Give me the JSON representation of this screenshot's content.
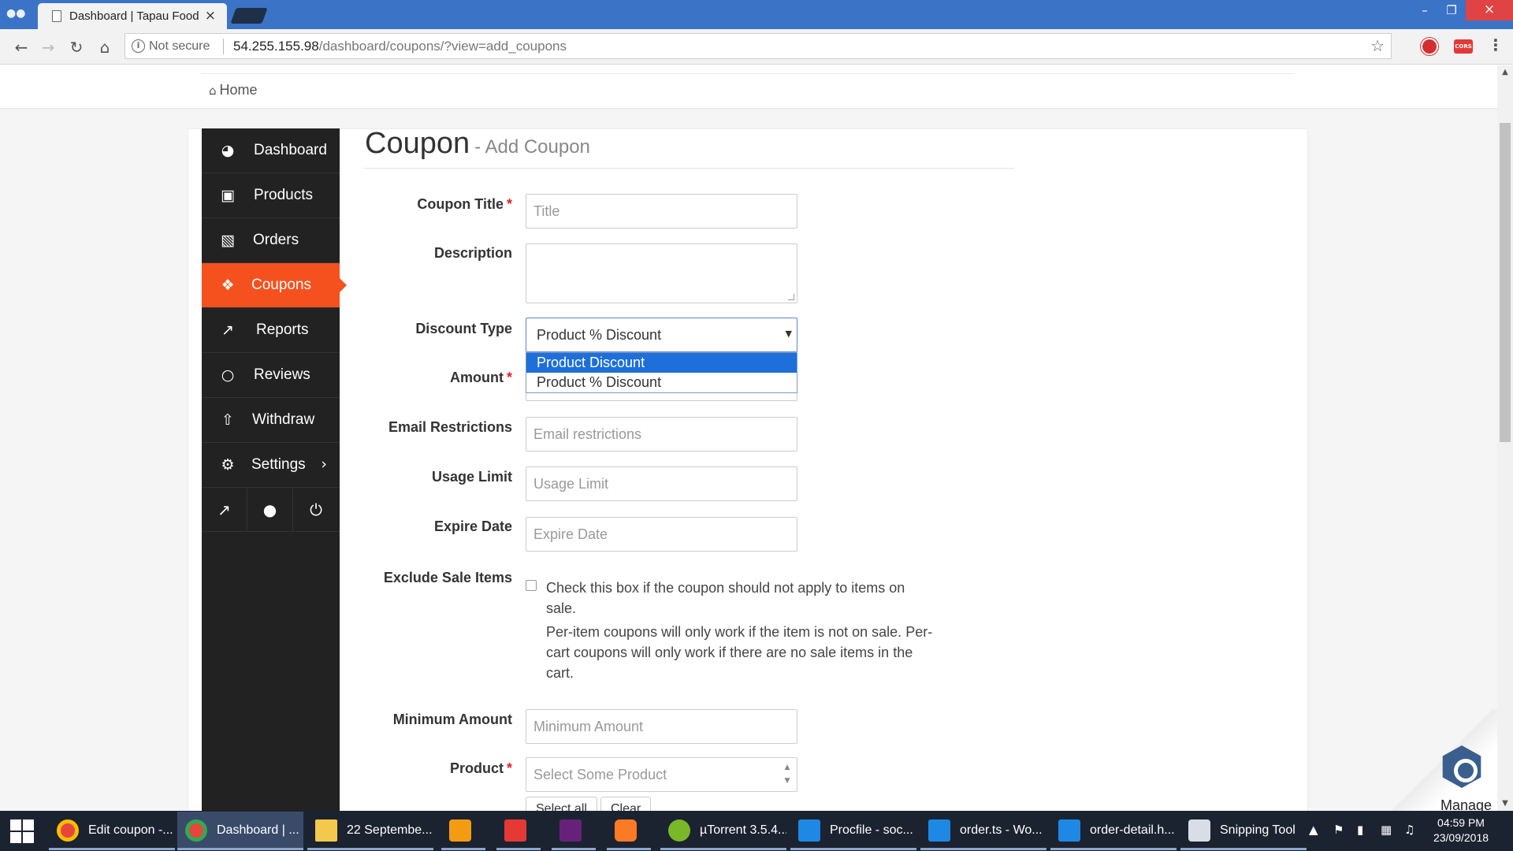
{
  "browser": {
    "tab_title": "Dashboard | Tapau Food",
    "security_label": "Not secure",
    "url_host": "54.255.155.98",
    "url_path": "/dashboard/coupons/?view=add_coupons"
  },
  "breadcrumb": {
    "home_label": "Home"
  },
  "sidebar": {
    "items": [
      {
        "label": "Dashboard",
        "icon": "dashboard-icon"
      },
      {
        "label": "Products",
        "icon": "briefcase-icon"
      },
      {
        "label": "Orders",
        "icon": "cart-icon"
      },
      {
        "label": "Coupons",
        "icon": "gift-icon",
        "active": true
      },
      {
        "label": "Reports",
        "icon": "chart-icon"
      },
      {
        "label": "Reviews",
        "icon": "comments-icon"
      },
      {
        "label": "Withdraw",
        "icon": "upload-icon"
      },
      {
        "label": "Settings",
        "icon": "gear-icon"
      }
    ],
    "bottom_icons": [
      "external-link-icon",
      "user-icon",
      "power-icon"
    ]
  },
  "page": {
    "title": "Coupon",
    "subtitle": "- Add Coupon"
  },
  "form": {
    "coupon_title": {
      "label": "Coupon Title",
      "placeholder": "Title",
      "required": true
    },
    "description": {
      "label": "Description"
    },
    "discount_type": {
      "label": "Discount Type",
      "selected": "Product % Discount",
      "options": [
        "Product Discount",
        "Product % Discount"
      ],
      "highlighted": "Product Discount"
    },
    "amount": {
      "label": "Amount",
      "required": true
    },
    "email_restrictions": {
      "label": "Email Restrictions",
      "placeholder": "Email restrictions"
    },
    "usage_limit": {
      "label": "Usage Limit",
      "placeholder": "Usage Limit"
    },
    "expire_date": {
      "label": "Expire Date",
      "placeholder": "Expire Date"
    },
    "exclude_sale_items": {
      "label": "Exclude Sale Items",
      "checkbox_text": "Check this box if the coupon should not apply to items on sale.",
      "help_text": "Per-item coupons will only work if the item is not on sale. Per-cart coupons will only work if there are no sale items in the cart."
    },
    "minimum_amount": {
      "label": "Minimum Amount",
      "placeholder": "Minimum Amount"
    },
    "product": {
      "label": "Product",
      "placeholder": "Select Some Product",
      "required": true
    },
    "select_all_label": "Select all",
    "clear_label": "Clear"
  },
  "widget": {
    "manage_label": "Manage"
  },
  "taskbar": {
    "items": [
      {
        "label": "Edit coupon -..."
      },
      {
        "label": "Dashboard | ..."
      },
      {
        "label": "22 Septembe..."
      },
      {
        "label": ""
      },
      {
        "label": ""
      },
      {
        "label": ""
      },
      {
        "label": ""
      },
      {
        "label": "µTorrent 3.5.4..."
      },
      {
        "label": "Procfile - soc..."
      },
      {
        "label": "order.ts - Wo..."
      },
      {
        "label": "order-detail.h..."
      },
      {
        "label": "Snipping Tool"
      }
    ],
    "time": "04:59 PM",
    "date": "23/09/2018"
  }
}
